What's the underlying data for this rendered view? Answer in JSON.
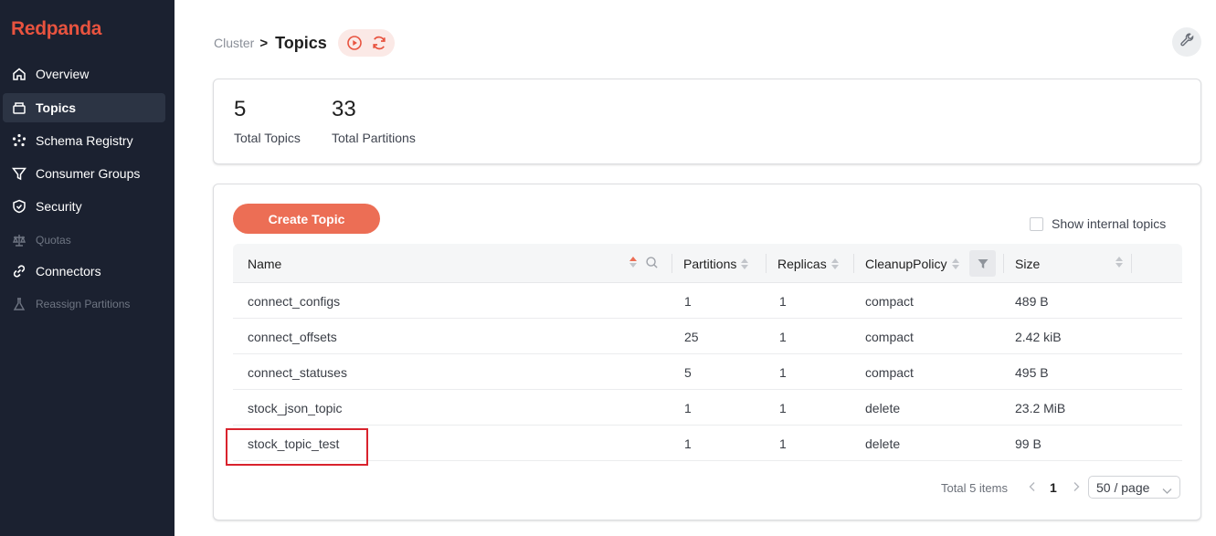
{
  "brand": {
    "name": "Redpanda",
    "accent": "#e8533f"
  },
  "sidebar": {
    "items": [
      {
        "label": "Overview",
        "icon": "home-icon"
      },
      {
        "label": "Topics",
        "icon": "topics-icon",
        "active": true
      },
      {
        "label": "Schema Registry",
        "icon": "schema-icon"
      },
      {
        "label": "Consumer Groups",
        "icon": "filter-funnel-icon"
      },
      {
        "label": "Security",
        "icon": "shield-icon"
      },
      {
        "label": "Quotas",
        "icon": "scale-icon",
        "disabled": true
      },
      {
        "label": "Connectors",
        "icon": "link-icon"
      },
      {
        "label": "Reassign Partitions",
        "icon": "flask-icon",
        "disabled": true
      }
    ]
  },
  "header": {
    "breadcrumb_root": "Cluster",
    "breadcrumb_sep": ">",
    "title": "Topics"
  },
  "stats": {
    "total_topics": {
      "value": "5",
      "label": "Total Topics"
    },
    "total_partitions": {
      "value": "33",
      "label": "Total Partitions"
    }
  },
  "toolbar": {
    "create_label": "Create Topic",
    "show_internal_label": "Show internal topics",
    "show_internal_checked": false
  },
  "table": {
    "columns": [
      "Name",
      "Partitions",
      "Replicas",
      "CleanupPolicy",
      "Size"
    ],
    "rows": [
      {
        "name": "connect_configs",
        "partitions": "1",
        "replicas": "1",
        "policy": "compact",
        "size": "489 B"
      },
      {
        "name": "connect_offsets",
        "partitions": "25",
        "replicas": "1",
        "policy": "compact",
        "size": "2.42 kiB"
      },
      {
        "name": "connect_statuses",
        "partitions": "5",
        "replicas": "1",
        "policy": "compact",
        "size": "495 B"
      },
      {
        "name": "stock_json_topic",
        "partitions": "1",
        "replicas": "1",
        "policy": "delete",
        "size": "23.2 MiB"
      },
      {
        "name": "stock_topic_test",
        "partitions": "1",
        "replicas": "1",
        "policy": "delete",
        "size": "99 B",
        "highlighted": true
      }
    ]
  },
  "pagination": {
    "total_label": "Total 5 items",
    "current_page": "1",
    "page_size": "50 / page"
  },
  "colors": {
    "sidebar_bg": "#1b2130",
    "highlight": "#d9232d",
    "button": "#ec6e55"
  }
}
